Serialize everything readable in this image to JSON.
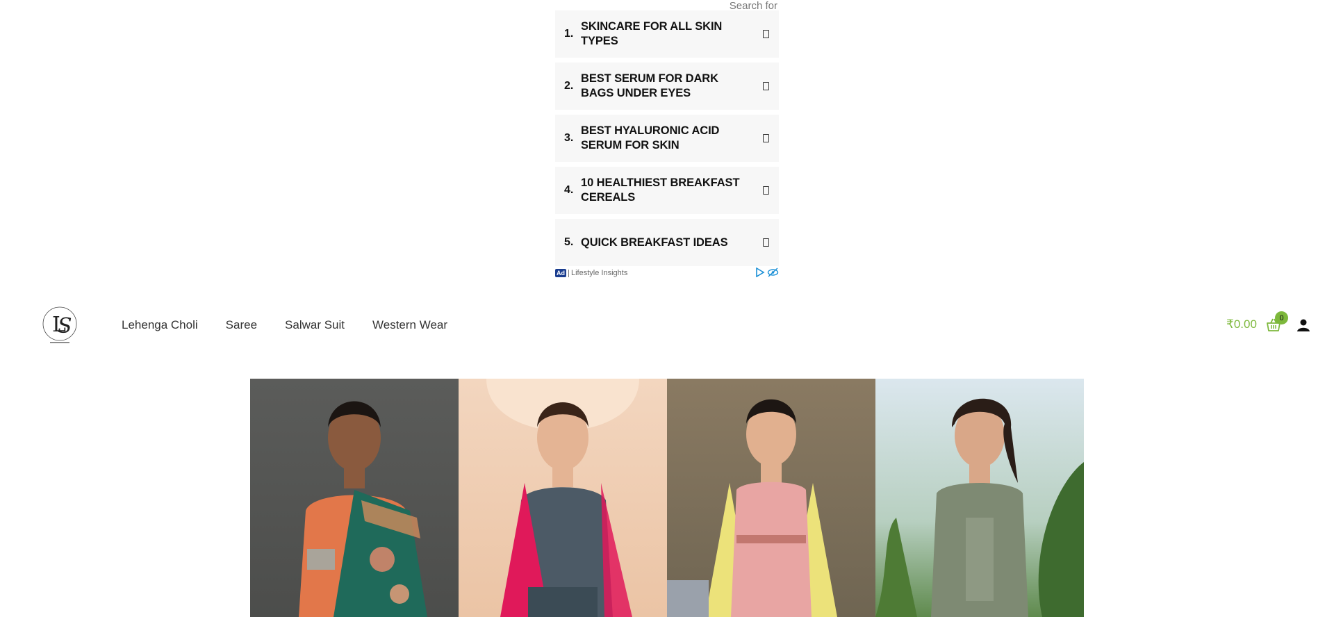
{
  "ad": {
    "search_for_label": "Search for",
    "items": [
      {
        "num": "1.",
        "text": "Skincare for All Skin Types"
      },
      {
        "num": "2.",
        "text": "Best Serum for Dark Bags Under Eyes"
      },
      {
        "num": "3.",
        "text": "Best Hyaluronic Acid Serum for Skin"
      },
      {
        "num": "4.",
        "text": "10 Healthiest Breakfast Cereals"
      },
      {
        "num": "5.",
        "text": "Quick Breakfast Ideas"
      }
    ],
    "badge": "Ad",
    "source": "Lifestyle Insights"
  },
  "header": {
    "logo_icon": "ls-monogram-logo",
    "nav": [
      "Lehenga Choli",
      "Saree",
      "Salwar Suit",
      "Western Wear"
    ],
    "cart_total": "₹0.00",
    "cart_count": "0",
    "accent_color": "#7db83b"
  },
  "banner": {
    "panels": [
      "saree-model-image",
      "lehenga-model-image",
      "salwar-suit-model-image",
      "kurti-model-image"
    ]
  }
}
